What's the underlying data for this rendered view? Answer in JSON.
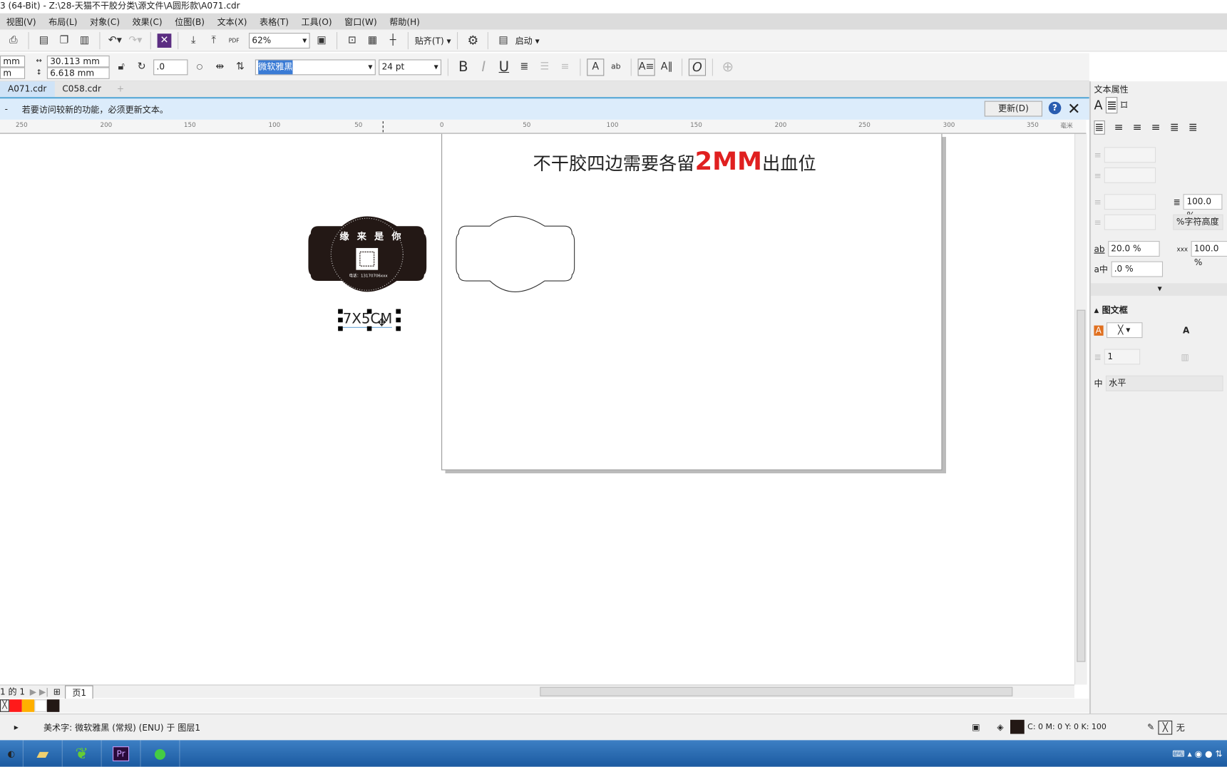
{
  "window": {
    "title": "3 (64-Bit) - Z:\\28-天猫不干胶分类\\源文件\\A圆形款\\A071.cdr"
  },
  "menu": [
    "视图(V)",
    "布局(L)",
    "对象(C)",
    "效果(C)",
    "位图(B)",
    "文本(X)",
    "表格(T)",
    "工具(O)",
    "窗口(W)",
    "帮助(H)"
  ],
  "toolbar": {
    "zoom": "62%",
    "snap": "贴齐(T)",
    "launch": "启动",
    "pdf": "PDF"
  },
  "propbar": {
    "x": "mm",
    "y": "m",
    "width": "30.113 mm",
    "height": "6.618 mm",
    "rotation": ".0",
    "font": "微软雅黑",
    "size": "24 pt",
    "bold": "B",
    "italic": "I",
    "underline": "U",
    "ab": "ab",
    "italic_o": "O"
  },
  "tabs": [
    {
      "label": "A071.cdr",
      "active": true
    },
    {
      "label": "C058.cdr",
      "active": false
    }
  ],
  "info": {
    "dash": "-",
    "message": "若要访问较新的功能，必须更新文本。",
    "update": "更新(D)"
  },
  "ruler": {
    "ticks": [
      "250",
      "200",
      "150",
      "100",
      "50",
      "0",
      "50",
      "100",
      "150",
      "200",
      "250",
      "300",
      "350"
    ],
    "unit": "毫米"
  },
  "canvas": {
    "headline_pre": "不干胶四边需要各留",
    "headline_mark": "2MM",
    "headline_post": "出血位",
    "label_title": "缘 来 是 你",
    "label_phone": "电话：13170706xxx",
    "size_text": "7X5CM"
  },
  "panel": {
    "title": "文本属性",
    "line_spacing": "100.0 %",
    "char_height": "%字符高度",
    "char_spacing": "20.0 %",
    "word_spacing": "100.0 %",
    "lang_spacing": ".0 %",
    "frame_section": "图文框",
    "columns": "1",
    "direction": "水平"
  },
  "pagenav": {
    "pages": "1 的 1",
    "page_tab": "页1"
  },
  "palette": [
    "#ff1a1a",
    "#ffb000",
    "#ffffff",
    "#231815"
  ],
  "status": {
    "object": "美术字: 微软雅黑 (常规) (ENU) 于 图层1",
    "fill": "C: 0 M: 0 Y: 0 K: 100",
    "outline": "无"
  },
  "colors": {
    "accent_red": "#e02020",
    "label_dark": "#231815"
  }
}
